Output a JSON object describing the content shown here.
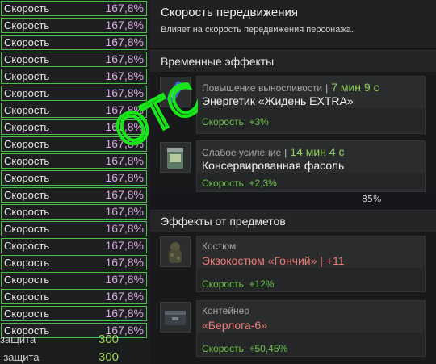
{
  "stats": [
    {
      "name": "Скорость",
      "value": "167,8%"
    },
    {
      "name": "Скорость",
      "value": "167,8%"
    },
    {
      "name": "Скорость",
      "value": "167,8%"
    },
    {
      "name": "Скорость",
      "value": "167,8%"
    },
    {
      "name": "Скорость",
      "value": "167,8%"
    },
    {
      "name": "Скорость",
      "value": "167,8%"
    },
    {
      "name": "Скорость",
      "value": "167,8%"
    },
    {
      "name": "Скорость",
      "value": "167,8%"
    },
    {
      "name": "Скорость",
      "value": "167,8%"
    },
    {
      "name": "Скорость",
      "value": "167,8%"
    },
    {
      "name": "Скорость",
      "value": "167,8%"
    },
    {
      "name": "Скорость",
      "value": "167,8%"
    },
    {
      "name": "Скорость",
      "value": "167,8%"
    },
    {
      "name": "Скорость",
      "value": "167,8%"
    },
    {
      "name": "Скорость",
      "value": "167,8%"
    },
    {
      "name": "Скорость",
      "value": "167,8%"
    },
    {
      "name": "Скорость",
      "value": "167,8%"
    },
    {
      "name": "Скорость",
      "value": "167,8%"
    },
    {
      "name": "Скорость",
      "value": "167,8%"
    },
    {
      "name": "Скорость",
      "value": "167,8%"
    }
  ],
  "plain_stats": [
    {
      "name": "защита",
      "value": "300"
    },
    {
      "name": "-защита",
      "value": "300"
    }
  ],
  "tooltip": {
    "title": "Скорость передвижения",
    "description": "Влияет на скорость передвижения персонажа.",
    "temporary": {
      "heading": "Временные эффекты",
      "items": [
        {
          "category": "Повышение выносливости",
          "separator": "|",
          "time": "7 мин 9 с",
          "name": "Энергетик «Жидень EXTRA»",
          "bonus": "Скорость: +3%"
        },
        {
          "category": "Слабое усиление",
          "separator": "|",
          "time": "14 мин 4 с",
          "name": "Консервированная фасоль",
          "bonus": "Скорость: +2,3%"
        }
      ]
    },
    "strip_text": "85%",
    "items_effects": {
      "heading": "Эффекты от предметов",
      "items": [
        {
          "category": "Костюм",
          "name": "Экзокостюм «Гончий» | +11",
          "bonus": "Скорость: +12%"
        },
        {
          "category": "Контейнер",
          "name": "«Берлога-6»",
          "bonus": "Скорость: +50,45%"
        }
      ]
    }
  },
  "watermark_text": "ОТС",
  "colors": {
    "accent_green": "#4bc04b",
    "value_pink": "#d9a6e0",
    "bonus_green": "#6cc34a",
    "time_green": "#8fd35b",
    "item_red": "#ec7a74"
  }
}
